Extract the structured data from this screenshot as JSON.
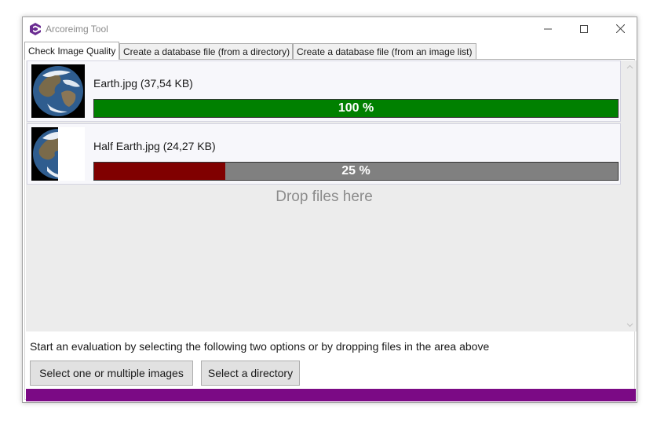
{
  "window": {
    "title": "Arcoreimg Tool",
    "accent_color": "#7b0a85"
  },
  "tabs": [
    {
      "label": "Check Image Quality",
      "active": true
    },
    {
      "label": "Create a database file (from a directory)",
      "active": false
    },
    {
      "label": "Create a database file (from an image list)",
      "active": false
    }
  ],
  "files": [
    {
      "label": "Earth.jpg (37,54 KB)",
      "thumbnail": "earth-image",
      "progress": 100,
      "progress_text": "100 %",
      "fill_color": "#008000"
    },
    {
      "label": "Half Earth.jpg (24,27 KB)",
      "thumbnail": "half-earth-image",
      "progress": 25,
      "progress_text": "25 %",
      "fill_color": "#800000"
    }
  ],
  "drop_hint": "Drop files here",
  "instruction": "Start an evaluation by selecting the following two options or by dropping files in the area above",
  "buttons": {
    "select_images": "Select one or multiple images",
    "select_directory": "Select a directory"
  },
  "icons": {
    "app": "arcoreimg-logo-icon",
    "minimize": "minimize-icon",
    "maximize": "maximize-icon",
    "close": "close-icon"
  }
}
